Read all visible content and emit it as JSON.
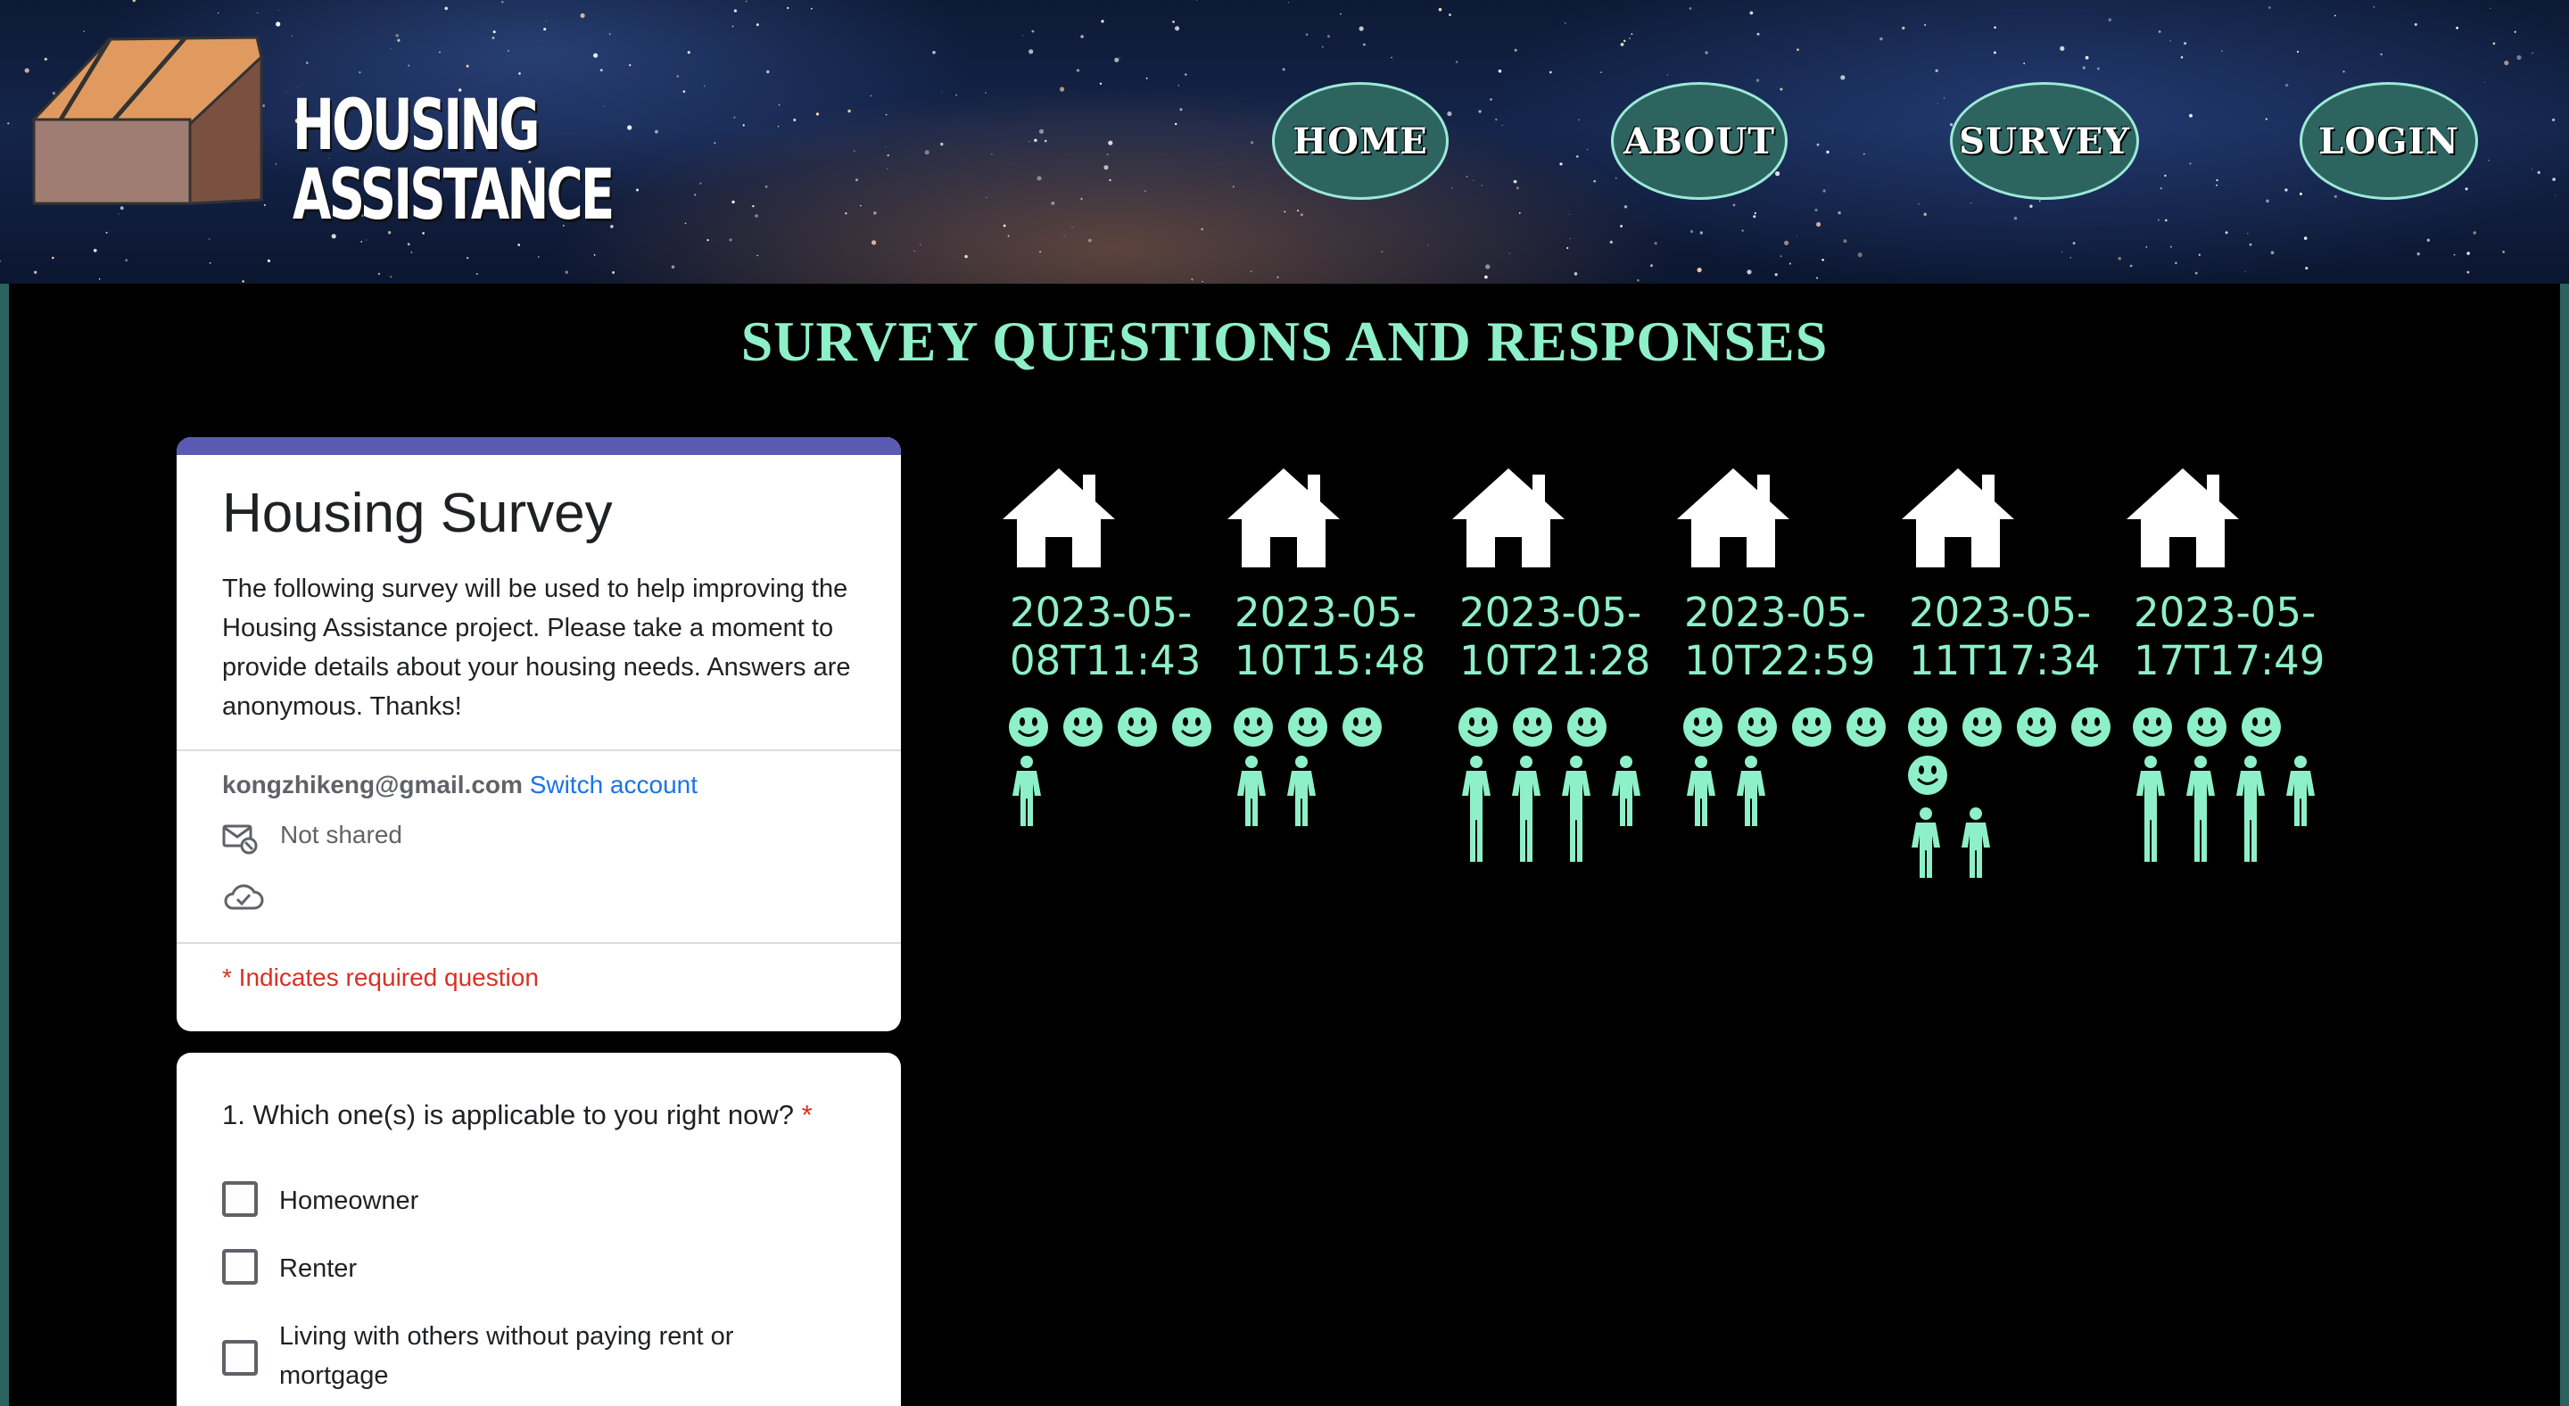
{
  "header": {
    "logo": {
      "line1": "HOUSING",
      "line2": "ASSISTANCE"
    },
    "nav": [
      {
        "label": "HOME"
      },
      {
        "label": "ABOUT"
      },
      {
        "label": "SURVEY"
      },
      {
        "label": "LOGIN"
      }
    ]
  },
  "page_title": "SURVEY QUESTIONS AND RESPONSES",
  "form": {
    "title": "Housing Survey",
    "description": "The following survey will be used to help improving the Housing Assistance project. Please take a moment to provide details about your housing needs. Answers are anonymous. Thanks!",
    "account_email": "kongzhikeng@gmail.com",
    "switch_account": "Switch account",
    "not_shared": "Not shared",
    "required_note": "* Indicates required question",
    "question1": {
      "text": "1. Which one(s) is applicable to you right now?",
      "required_mark": "*",
      "options": [
        "Homeowner",
        "Renter",
        "Living with others without paying rent or mortgage"
      ]
    }
  },
  "responses": [
    {
      "date_line1": "2023-05-",
      "date_line2": "08T11:43",
      "smiles": 4,
      "people": 1,
      "tall_people": 0
    },
    {
      "date_line1": "2023-05-",
      "date_line2": "10T15:48",
      "smiles": 3,
      "people": 2,
      "tall_people": 0
    },
    {
      "date_line1": "2023-05-",
      "date_line2": "10T21:28",
      "smiles": 3,
      "people": 4,
      "tall_people": 3
    },
    {
      "date_line1": "2023-05-",
      "date_line2": "10T22:59",
      "smiles": 4,
      "people": 2,
      "tall_people": 0
    },
    {
      "date_line1": "2023-05-",
      "date_line2": "11T17:34",
      "smiles": 5,
      "people": 2,
      "tall_people": 0
    },
    {
      "date_line1": "2023-05-",
      "date_line2": "17T17:49",
      "smiles": 3,
      "people": 4,
      "tall_people": 3
    }
  ],
  "colors": {
    "accent": "#8ef0c8",
    "nav_fill": "#2d6460",
    "form_bar": "#5a5ab4",
    "required": "#d93025",
    "link": "#1a73e8"
  }
}
